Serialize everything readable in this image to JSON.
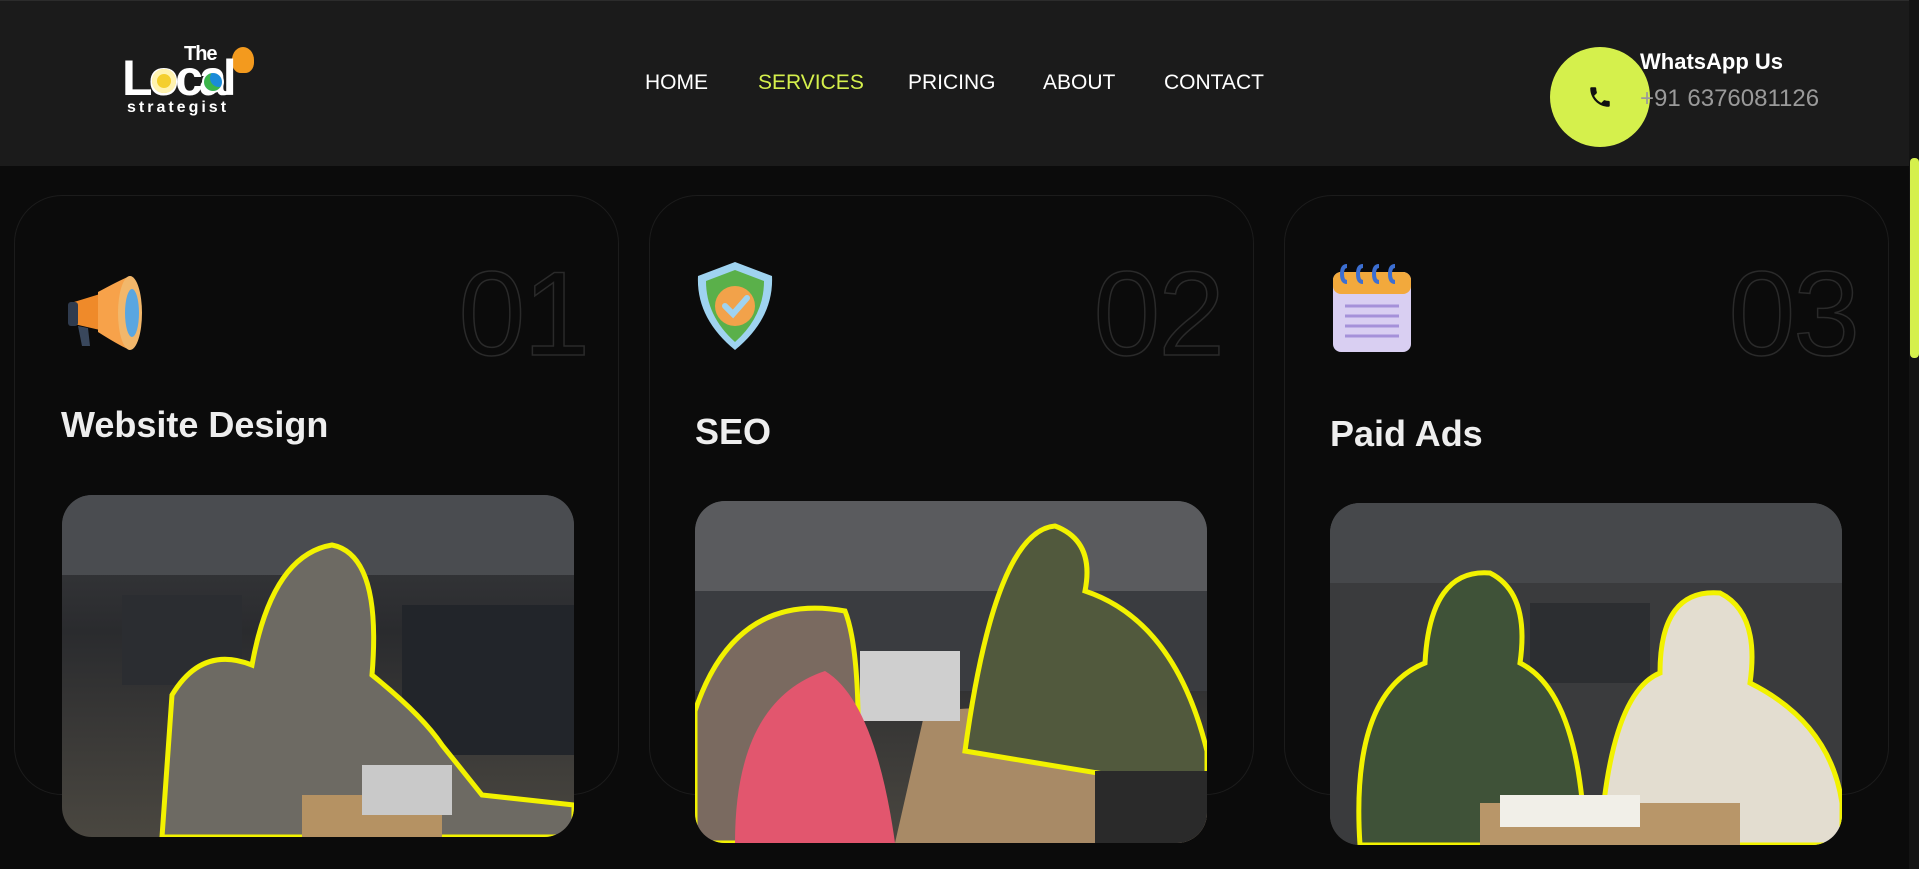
{
  "header": {
    "logo": {
      "word_the": "The",
      "word_local": "Local",
      "word_strategist": "strategist"
    },
    "nav": [
      {
        "label": "HOME",
        "active": false
      },
      {
        "label": "SERVICES",
        "active": true
      },
      {
        "label": "PRICING",
        "active": false
      },
      {
        "label": "ABOUT",
        "active": false
      },
      {
        "label": "CONTACT",
        "active": false
      }
    ],
    "whatsapp": {
      "title": "WhatsApp Us",
      "phone": "+91 6376081126",
      "icon": "phone-icon"
    }
  },
  "services": [
    {
      "number": "01",
      "title": "Website Design",
      "icon": "megaphone-icon"
    },
    {
      "number": "02",
      "title": "SEO",
      "icon": "shield-check-icon"
    },
    {
      "number": "03",
      "title": "Paid Ads",
      "icon": "notepad-icon"
    }
  ],
  "colors": {
    "accent": "#d5f04c",
    "background": "#0b0b0b",
    "header": "#1b1b1b",
    "outline": "#f2f200"
  }
}
